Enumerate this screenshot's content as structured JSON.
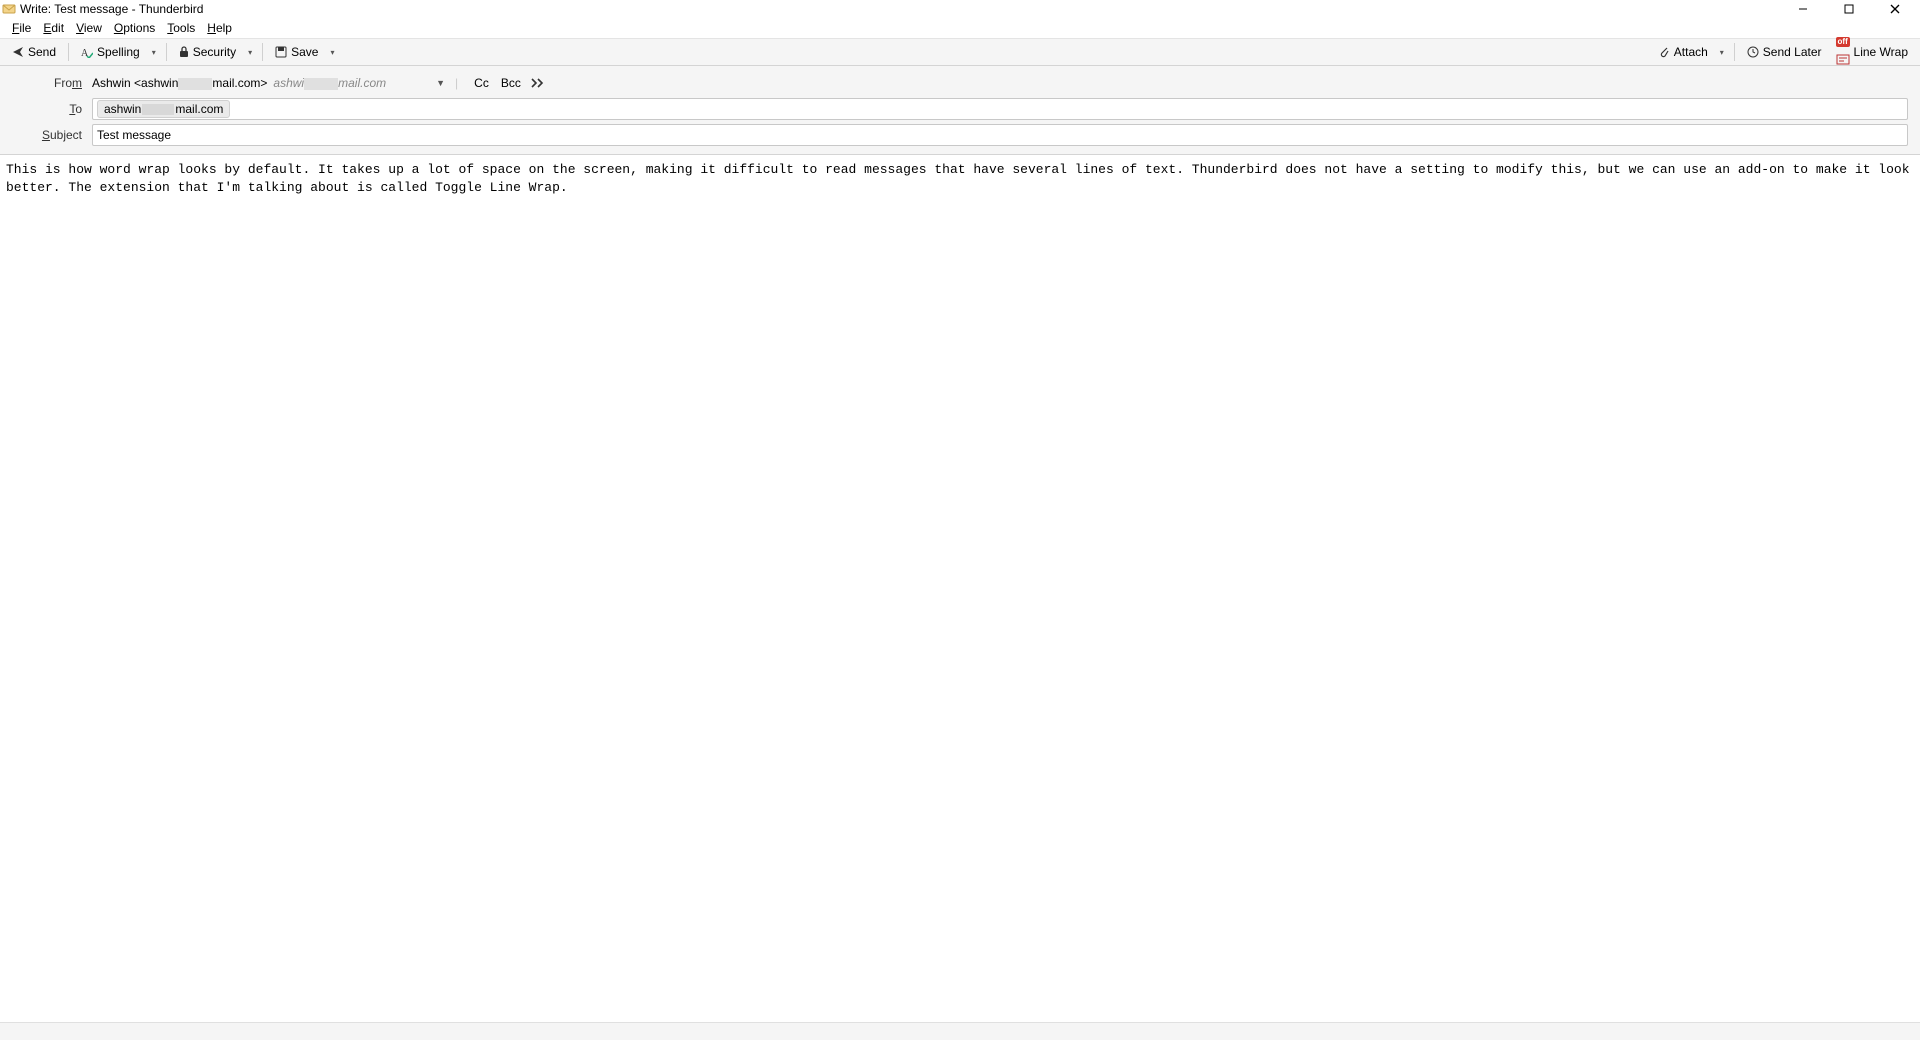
{
  "window": {
    "title": "Write: Test message - Thunderbird"
  },
  "menu": {
    "file": "File",
    "edit": "Edit",
    "view": "View",
    "options": "Options",
    "tools": "Tools",
    "help": "Help"
  },
  "toolbar": {
    "send": "Send",
    "spelling": "Spelling",
    "security": "Security",
    "save": "Save",
    "attach": "Attach",
    "send_later": "Send Later",
    "line_wrap": "Line Wrap",
    "line_wrap_badge": "off"
  },
  "headers": {
    "from_label": "From",
    "from_name": "Ashwin",
    "from_addr_prefix": "<ashwin",
    "from_addr_suffix": "mail.com>",
    "from_secondary_prefix": "ashwi",
    "from_secondary_suffix": "mail.com",
    "cc": "Cc",
    "bcc": "Bcc",
    "to_label": "To",
    "to_prefix": "ashwin",
    "to_suffix": "mail.com",
    "subject_label": "Subject",
    "subject_value": "Test message"
  },
  "body": "This is how word wrap looks by default. It takes up a lot of space on the screen, making it difficult to read messages that have several lines of text. Thunderbird does not have a setting to modify this, but we can use an add-on to make it look better. The extension that I'm talking about is called Toggle Line Wrap."
}
